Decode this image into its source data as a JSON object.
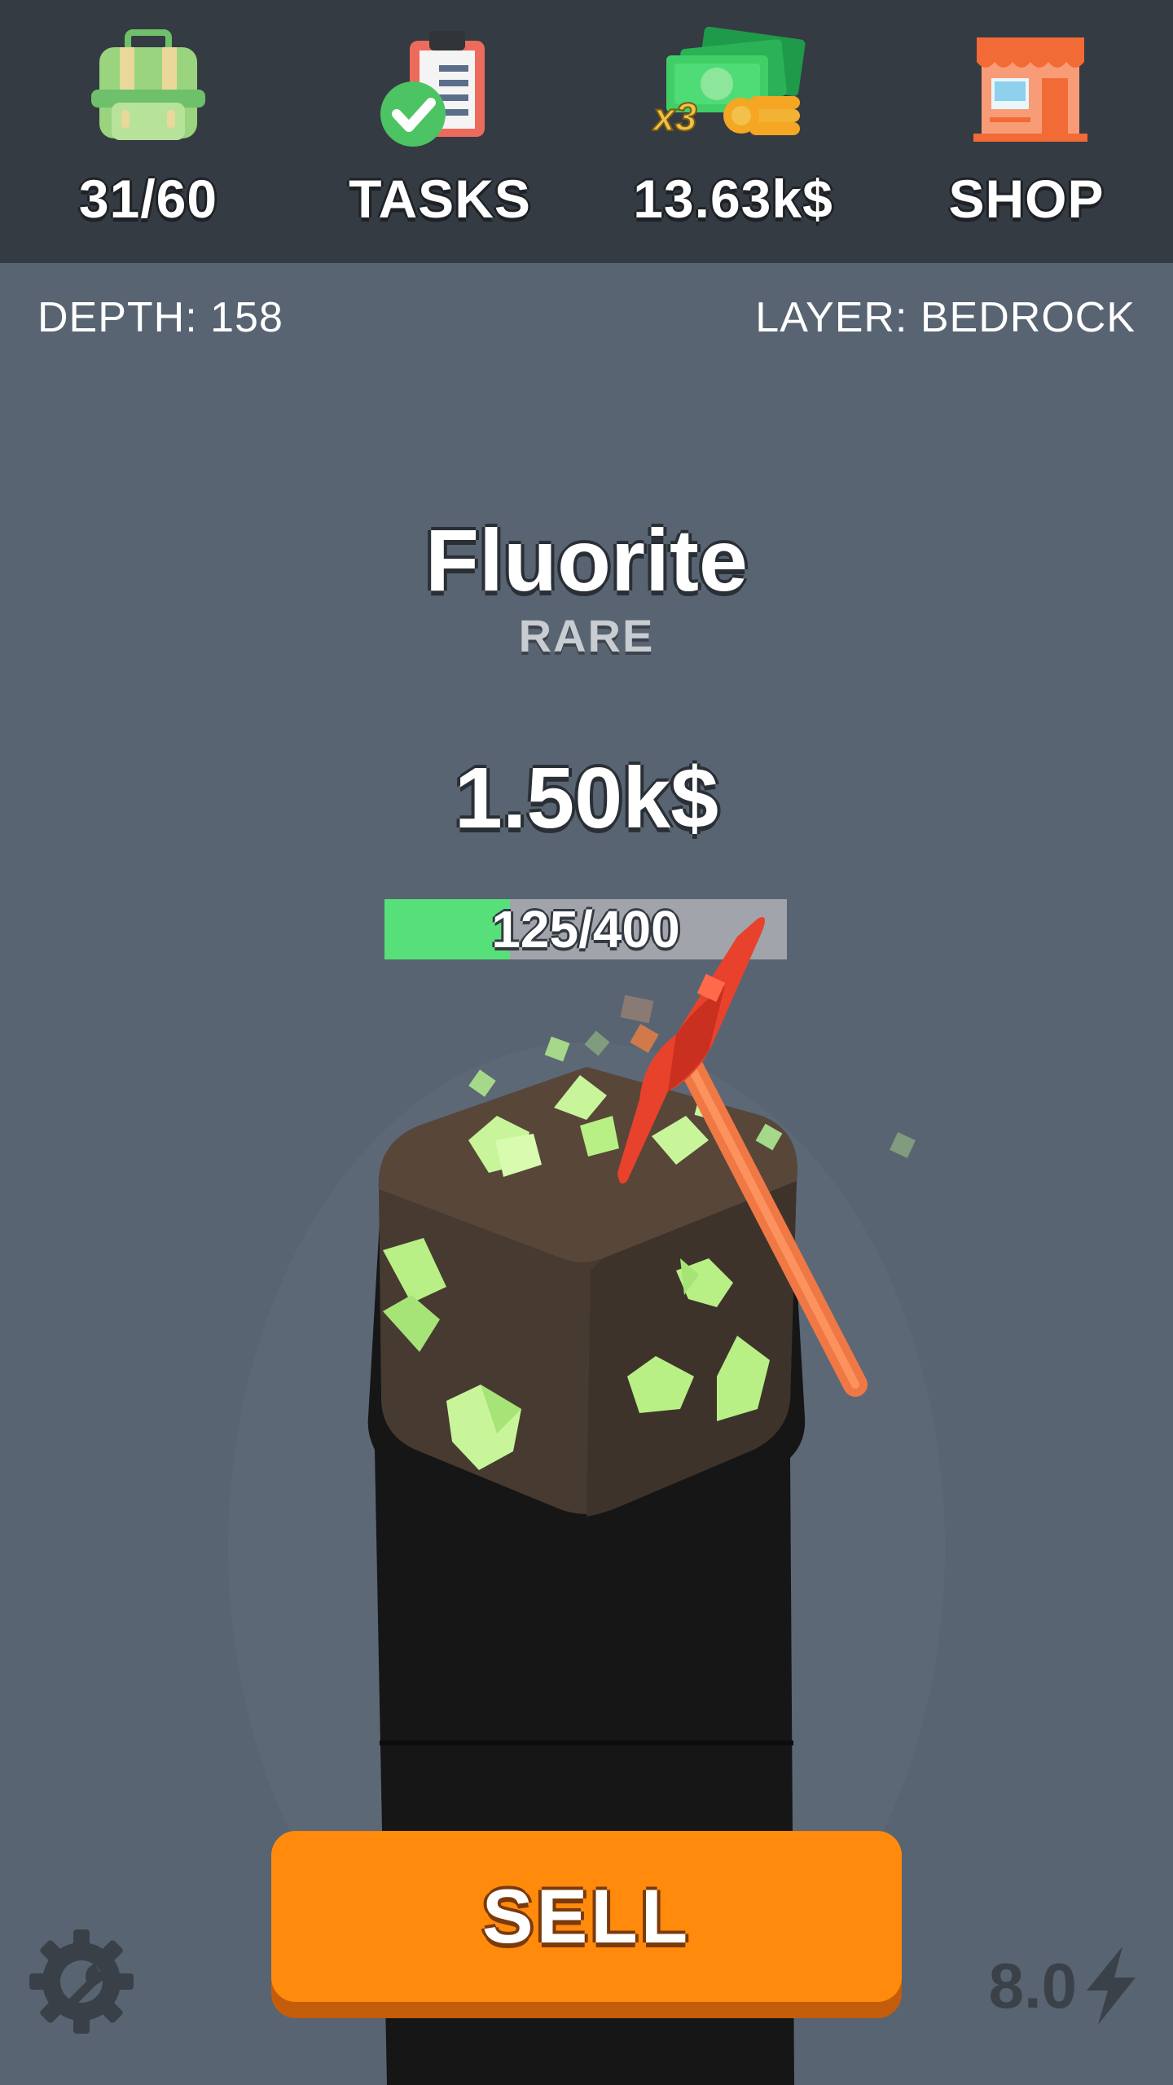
{
  "topbar": {
    "backpack": {
      "icon": "backpack-icon",
      "label": "31/60"
    },
    "tasks": {
      "icon": "clipboard-check-icon",
      "label": "TASKS"
    },
    "money": {
      "icon": "cash-stack-icon",
      "multiplier": "x3",
      "label": "13.63k$"
    },
    "shop": {
      "icon": "shop-icon",
      "label": "SHOP"
    }
  },
  "hud": {
    "depth": "DEPTH: 158",
    "layer": "LAYER: BEDROCK"
  },
  "ore": {
    "name": "Fluorite",
    "rarity": "RARE",
    "price": "1.50k$",
    "progress": {
      "current": 125,
      "max": 400,
      "label": "125/400"
    }
  },
  "sell_button": {
    "label": "SELL"
  },
  "settings": {
    "icon": "settings-wrench-icon"
  },
  "speed": {
    "value": "8.0",
    "icon": "lightning-bolt-icon"
  },
  "colors": {
    "background": "#586472",
    "topbar": "#353b43",
    "progress_fill": "#57e07a",
    "sell_button": "#ff8a0c",
    "ore_crystal": "#b8f086",
    "pickaxe": "#e8422c"
  }
}
